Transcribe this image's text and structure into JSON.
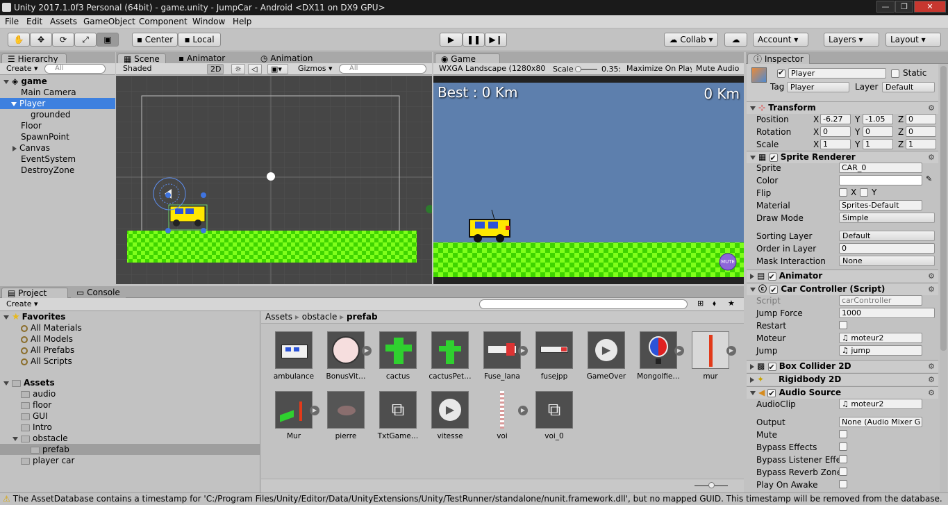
{
  "window": {
    "title": "Unity 2017.1.0f3 Personal (64bit) - game.unity - JumpCar - Android <DX11 on DX9 GPU>",
    "min": "—",
    "max": "❐",
    "close": "✕"
  },
  "menu": [
    "File",
    "Edit",
    "Assets",
    "GameObject",
    "Component",
    "Window",
    "Help"
  ],
  "toolbar": {
    "center": "Center",
    "local": "Local",
    "collab": "Collab",
    "account": "Account",
    "layers": "Layers",
    "layout": "Layout"
  },
  "hierarchy": {
    "tab": "Hierarchy",
    "create": "Create",
    "search": "All",
    "scene": "game",
    "items": [
      {
        "label": "Main Camera"
      },
      {
        "label": "Player"
      },
      {
        "label": "grounded"
      },
      {
        "label": "Floor"
      },
      {
        "label": "SpawnPoint"
      },
      {
        "label": "Canvas"
      },
      {
        "label": "EventSystem"
      },
      {
        "label": "DestroyZone"
      }
    ]
  },
  "scene": {
    "tabs": [
      "Scene",
      "Animator",
      "Animation"
    ],
    "shading": "Shaded",
    "mode2d": "2D",
    "gizmos": "Gizmos",
    "search": "All"
  },
  "game": {
    "tab": "Game",
    "resolution": "WXGA Landscape (1280x80",
    "scale_label": "Scale",
    "scale_value": "0.35:",
    "maximize": "Maximize On Play",
    "mute_audio": "Mute Audio",
    "best": "Best : 0 Km",
    "distance": "0 Km",
    "mute_btn": "MUTE"
  },
  "inspector": {
    "tab": "Inspector",
    "name": "Player",
    "static": "Static",
    "tag_label": "Tag",
    "tag": "Player",
    "layer_label": "Layer",
    "layer": "Default",
    "transform": {
      "title": "Transform",
      "position_label": "Position",
      "rotation_label": "Rotation",
      "scale_label": "Scale",
      "position": [
        "-6.27",
        "-1.05",
        "0"
      ],
      "rotation": [
        "0",
        "0",
        "0"
      ],
      "scale": [
        "1",
        "1",
        "1"
      ]
    },
    "sprite_renderer": {
      "title": "Sprite Renderer",
      "sprite_label": "Sprite",
      "sprite": "CAR_0",
      "color_label": "Color",
      "flip_label": "Flip",
      "flip_x": "X",
      "flip_y": "Y",
      "material_label": "Material",
      "material": "Sprites-Default",
      "drawmode_label": "Draw Mode",
      "drawmode": "Simple",
      "sorting_label": "Sorting Layer",
      "sorting": "Default",
      "order_label": "Order in Layer",
      "order": "0",
      "mask_label": "Mask Interaction",
      "mask": "None"
    },
    "animator": {
      "title": "Animator"
    },
    "car_controller": {
      "title": "Car Controller (Script)",
      "script_label": "Script",
      "script": "carController",
      "jump_force_label": "Jump Force",
      "jump_force": "1000",
      "restart_label": "Restart",
      "moteur_label": "Moteur",
      "moteur": "moteur2",
      "jump_label": "Jump",
      "jump": "jump"
    },
    "box_collider": {
      "title": "Box Collider 2D"
    },
    "rigidbody": {
      "title": "Rigidbody 2D"
    },
    "audio_source": {
      "title": "Audio Source",
      "clip_label": "AudioClip",
      "clip": "moteur2",
      "output_label": "Output",
      "output": "None (Audio Mixer G",
      "mute_label": "Mute",
      "bypass_effects_label": "Bypass Effects",
      "bypass_listener_label": "Bypass Listener Effe",
      "bypass_reverb_label": "Bypass Reverb Zone",
      "play_on_awake_label": "Play On Awake"
    }
  },
  "project": {
    "tabs": [
      "Project",
      "Console"
    ],
    "create": "Create",
    "favorites_label": "Favorites",
    "favorites": [
      "All Materials",
      "All Models",
      "All Prefabs",
      "All Scripts"
    ],
    "assets_label": "Assets",
    "folders": [
      "audio",
      "floor",
      "GUI",
      "Intro",
      "obstacle",
      "prefab",
      "player car"
    ],
    "breadcrumb": [
      "Assets",
      "obstacle",
      "prefab"
    ],
    "assets": [
      {
        "name": "ambulance"
      },
      {
        "name": "BonusVit…"
      },
      {
        "name": "cactus"
      },
      {
        "name": "cactusPet…"
      },
      {
        "name": "Fuse_lana"
      },
      {
        "name": "fusejpp"
      },
      {
        "name": "GameOver"
      },
      {
        "name": "Mongolfie…"
      },
      {
        "name": "mur"
      },
      {
        "name": "Mur"
      },
      {
        "name": "pierre"
      },
      {
        "name": "TxtGame…"
      },
      {
        "name": "vitesse"
      },
      {
        "name": "voi"
      },
      {
        "name": "voi_0"
      }
    ]
  },
  "console": {
    "message": "The AssetDatabase contains a timestamp for 'C:/Program Files/Unity/Editor/Data/UnityExtensions/Unity/TestRunner/standalone/nunit.framework.dll', but no mapped GUID. This timestamp will be removed from the database."
  },
  "colors": {
    "selection": "#3d80df",
    "game_sky": "#5d7fad",
    "grass_a": "#3fd400",
    "grass_b": "#7fff1a",
    "scene_bg": "#464646"
  }
}
